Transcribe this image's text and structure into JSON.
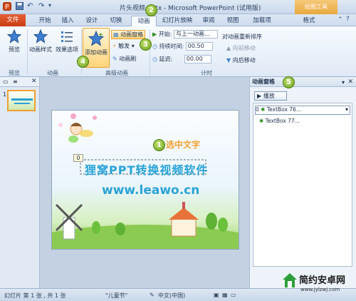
{
  "titlebar": {
    "title": "片头视频.pptx - Microsoft PowerPoint (试用版)",
    "contextual_tab": "绘图工具"
  },
  "tabs": [
    "文件",
    "开始",
    "插入",
    "设计",
    "切换",
    "动画",
    "幻灯片放映",
    "审阅",
    "视图",
    "加载项",
    "格式"
  ],
  "ribbon": {
    "preview": "预览",
    "animation_style": "动画样式",
    "effect_options": "效果选项",
    "add_animation": "添加动画",
    "animation_pane": "动画窗格",
    "trigger": "触发",
    "animation_painter": "动画刷",
    "start_label": "开始:",
    "start_value": "与上一动画...",
    "duration_label": "持续时间:",
    "duration_value": "00.50",
    "delay_label": "延迟:",
    "delay_value": "00.00",
    "reorder": "对动画重新排序",
    "move_earlier": "向前移动",
    "move_later": "向后移动",
    "groups": [
      "预览",
      "动画",
      "高级动画",
      "计时"
    ]
  },
  "callouts": [
    "1",
    "2",
    "3",
    "4",
    "5"
  ],
  "slide": {
    "select_text_note": "选中文字",
    "title_text": "狸窝PPT转换视频软件",
    "url_text": "www.leawo.cn",
    "anim_tag": "0"
  },
  "left_panel": {
    "slide_number": "1"
  },
  "animation_pane": {
    "title": "动画窗格",
    "play_button": "播放",
    "items": [
      {
        "order": "0",
        "name": "TextBox 76..."
      },
      {
        "name": "TextBox 77..."
      }
    ]
  },
  "status": {
    "slide_info": "幻灯片 第 1 张 , 共 1 张",
    "theme": "\"儿童节\"",
    "language": "中文(中国)"
  },
  "watermark": {
    "brand": "简约安卓网",
    "url": "www.jylzwj.com"
  },
  "colors": {
    "file_tab": "#d04a1c",
    "callout": "#6aa21d",
    "title_text": "#29a3d8",
    "accent_orange": "#f0a030"
  }
}
